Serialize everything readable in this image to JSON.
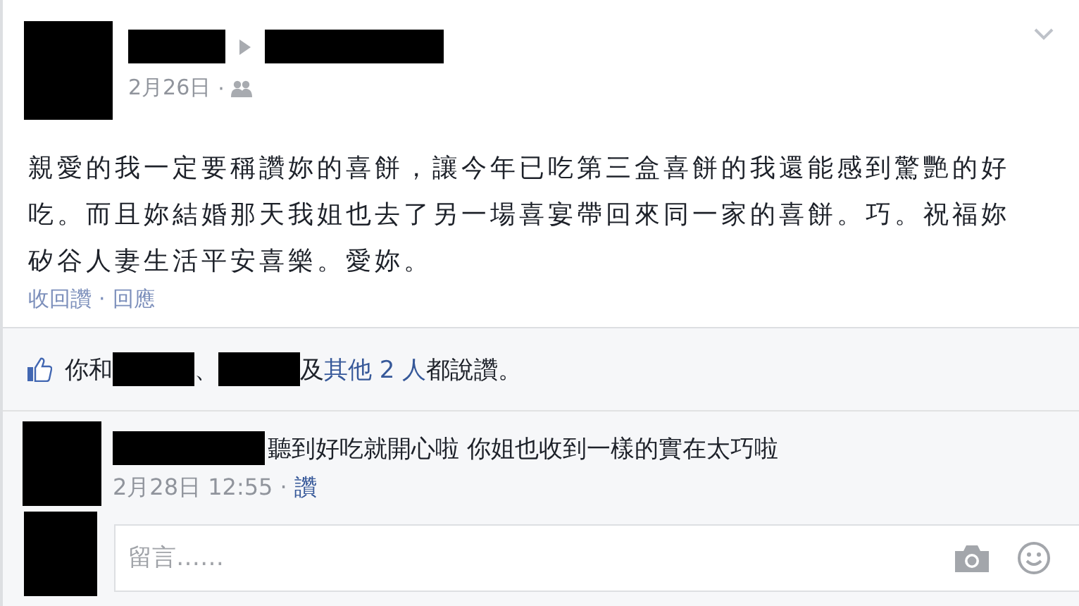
{
  "post": {
    "date": "2月26日",
    "separator": "·",
    "text": "親愛的我一定要稱讚妳的喜餅，讓今年已吃第三盒喜餅的我還能感到驚艷的好吃。而且妳結婚那天我姐也去了另一場喜宴帶回來同一家的喜餅。巧。祝福妳矽谷人妻生活平安喜樂。愛妳。",
    "actions": [
      "收回讚",
      "回應"
    ],
    "actions_separator": "·"
  },
  "likes": {
    "prefix": "你和",
    "joiner": "、",
    "and": "及",
    "others_link": "其他 2 人",
    "suffix": "都說讚。"
  },
  "comments": [
    {
      "text": "聽到好吃就開心啦 你姐也收到一樣的實在太巧啦",
      "time": "2月28日 12:55",
      "separator": "·",
      "like_link": "讚"
    }
  ],
  "comment_box": {
    "placeholder": "留言……"
  }
}
